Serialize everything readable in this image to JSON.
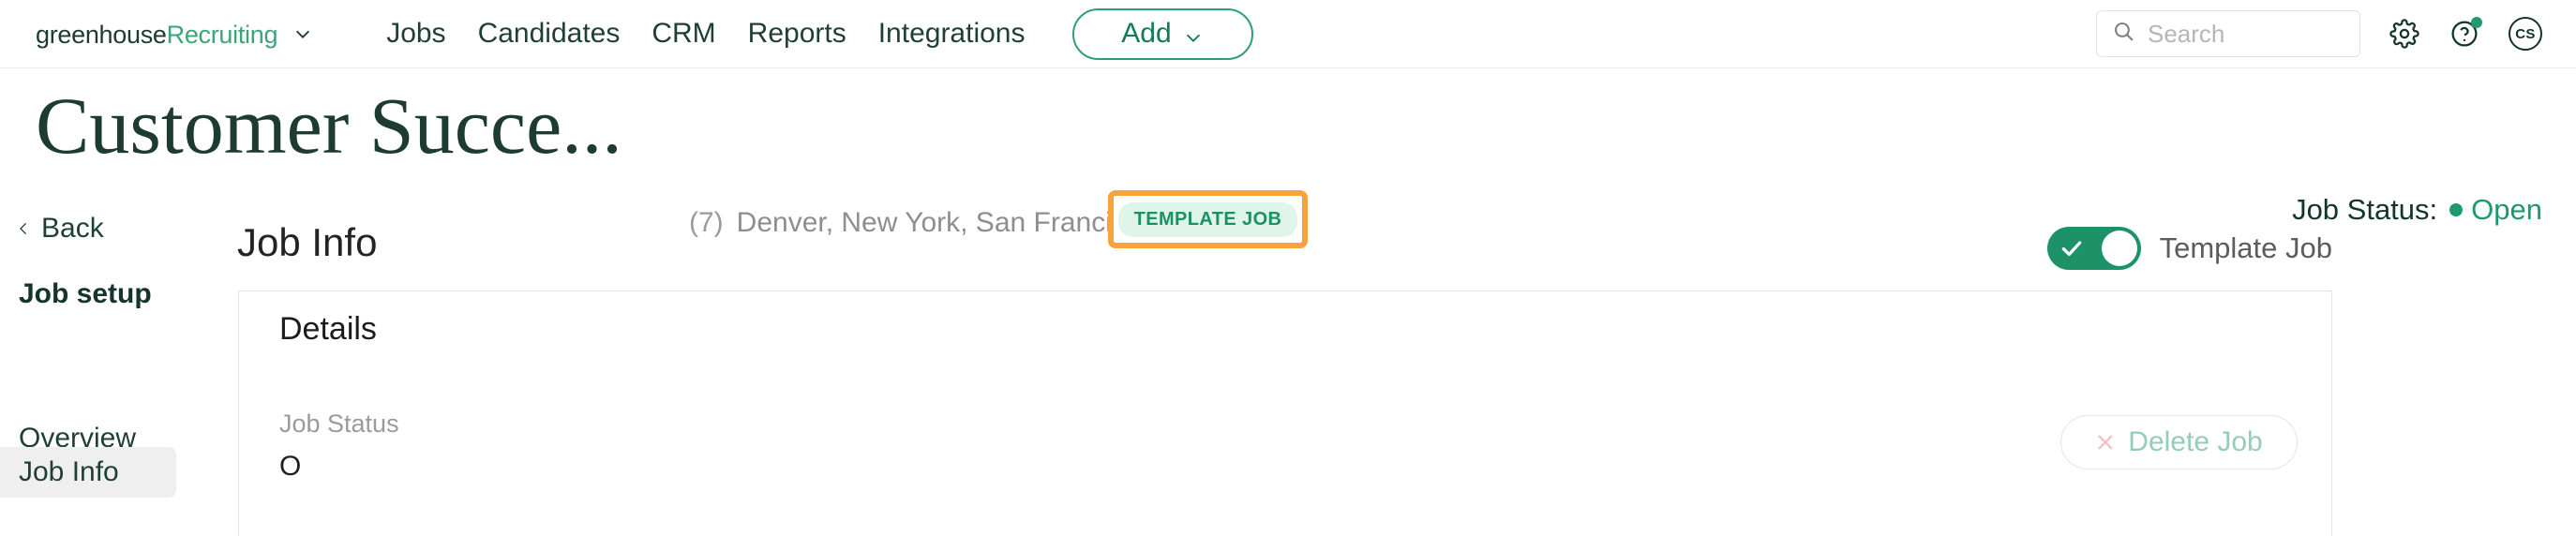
{
  "topnav": {
    "brand": {
      "primary": "greenhouse",
      "secondary": "Recruiting",
      "caret_icon": "chevron-down-icon"
    },
    "links": [
      {
        "label": "Jobs"
      },
      {
        "label": "Candidates"
      },
      {
        "label": "CRM"
      },
      {
        "label": "Reports"
      },
      {
        "label": "Integrations"
      }
    ],
    "add_button": {
      "label": "Add",
      "caret_icon": "chevron-down-icon"
    },
    "search": {
      "placeholder": "Search",
      "value": "",
      "icon": "search-icon"
    },
    "settings_icon": "gear-icon",
    "help_icon": "question-circle-icon",
    "avatar": {
      "initials": "CS"
    }
  },
  "header": {
    "title": "Customer Succe...",
    "count": "(7)",
    "locations": "Denver, New York, San Francisco",
    "template_badge": "TEMPLATE JOB",
    "highlight_color": "#f7a23b",
    "status_label": "Job Status:",
    "status_value": "Open",
    "status_color": "#1d9a6c"
  },
  "sidebar": {
    "back": {
      "label": "Back",
      "icon": "chevron-left-icon"
    },
    "heading": "Job setup",
    "items": [
      {
        "label": "Overview",
        "active": false
      },
      {
        "label": "Job Info",
        "active": true
      }
    ]
  },
  "main": {
    "title": "Job Info",
    "toggle": {
      "label": "Template Job",
      "state": "on",
      "icon": "check-icon",
      "color": "#1d9168"
    },
    "card": {
      "title": "Details",
      "field_label": "Job Status",
      "field_value": "O",
      "delete_button": {
        "label": "Delete Job",
        "icon": "x-icon"
      }
    }
  }
}
